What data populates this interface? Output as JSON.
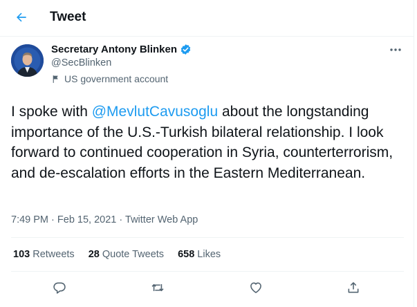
{
  "header": {
    "title": "Tweet"
  },
  "author": {
    "name": "Secretary Antony Blinken",
    "handle": "@SecBlinken",
    "label": "US government account",
    "verified": true
  },
  "tweet": {
    "text_before": "I spoke with ",
    "mention": "@MevlutCavusoglu",
    "text_after": " about the longstanding importance of the U.S.-Turkish bilateral relationship. I look forward to continued cooperation in Syria, counterterrorism, and de-escalation efforts in the Eastern Mediterranean."
  },
  "meta": {
    "time": "7:49 PM",
    "sep1": "·",
    "date": "Feb 15, 2021",
    "sep2": "·",
    "source": "Twitter Web App"
  },
  "stats": {
    "retweets_count": "103",
    "retweets_label": "Retweets",
    "quotes_count": "28",
    "quotes_label": "Quote Tweets",
    "likes_count": "658",
    "likes_label": "Likes"
  },
  "colors": {
    "accent": "#1d9bf0",
    "text": "#0f1419",
    "secondary": "#536471",
    "divider": "#eff3f4"
  },
  "icons": [
    "back-arrow-icon",
    "verified-badge-icon",
    "flag-icon",
    "more-icon",
    "reply-icon",
    "retweet-icon",
    "like-icon",
    "share-icon"
  ]
}
